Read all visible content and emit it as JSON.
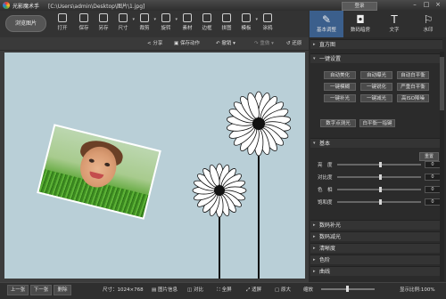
{
  "title_bar": {
    "app_name": "光影魔术手",
    "file_path": "[C:\\Users\\admin\\Desktop\\图片\\1.jpg]",
    "login_label": "登录",
    "minimize_glyph": "–",
    "maximize_glyph": "□",
    "close_glyph": "×"
  },
  "toolbar": {
    "browse_label": "浏览图片",
    "tools": [
      {
        "label": "打开",
        "icon": "folder-icon"
      },
      {
        "label": "保存",
        "icon": "save-icon"
      },
      {
        "label": "另存",
        "icon": "save-as-icon"
      },
      {
        "label": "尺寸",
        "icon": "resize-icon"
      },
      {
        "label": "裁剪",
        "icon": "crop-icon"
      },
      {
        "label": "旋转",
        "icon": "rotate-icon"
      },
      {
        "label": "素材",
        "icon": "material-icon"
      },
      {
        "label": "边框",
        "icon": "border-icon"
      },
      {
        "label": "拼图",
        "icon": "collage-icon"
      },
      {
        "label": "模板",
        "icon": "template-icon"
      },
      {
        "label": "涂鸦",
        "icon": "doodle-icon"
      }
    ]
  },
  "right_tabs": [
    {
      "label": "基本调整",
      "glyph": "✎",
      "active": true
    },
    {
      "label": "数码暗房",
      "glyph": "◘",
      "active": false
    },
    {
      "label": "文字",
      "glyph": "T",
      "active": false
    },
    {
      "label": "水印",
      "glyph": "⚐",
      "active": false
    }
  ],
  "subbar": {
    "share": "分享",
    "save_action": "保存动作",
    "undo": "撤销",
    "redo": "重做",
    "restore": "还原"
  },
  "panel": {
    "histogram": "直方图",
    "one_click": "一键设置",
    "one_click_buttons": [
      "自动美化",
      "自动曝光",
      "自动白平衡",
      "一键模糊",
      "一键锐化",
      "严重白平衡",
      "一键补光",
      "一键减光",
      "高ISO降噪"
    ],
    "extra_buttons": [
      "数字点测光",
      "白平衡一指键"
    ],
    "basic": "基本",
    "reset": "重置",
    "sliders": [
      {
        "label": "亮　度",
        "value": 0
      },
      {
        "label": "对比度",
        "value": 0
      },
      {
        "label": "色　相",
        "value": 0
      },
      {
        "label": "饱和度",
        "value": 0
      }
    ],
    "sections": [
      "数码补光",
      "数码减光",
      "清晰度",
      "色阶",
      "曲线"
    ]
  },
  "bottom": {
    "prev": "上一张",
    "next": "下一张",
    "remove": "删除",
    "size": "尺寸：1024×768",
    "info": "图片信息",
    "compare": "对比",
    "fullscreen": "全屏",
    "fit": "适屏",
    "original": "原大",
    "zoom_label": "缩放",
    "zoom_value": "显示比例:100%"
  },
  "colors": {
    "canvas_bg": "#b9cfd7",
    "active_tab": "#3b5f8c",
    "panel_bg": "#2b2b2b"
  }
}
